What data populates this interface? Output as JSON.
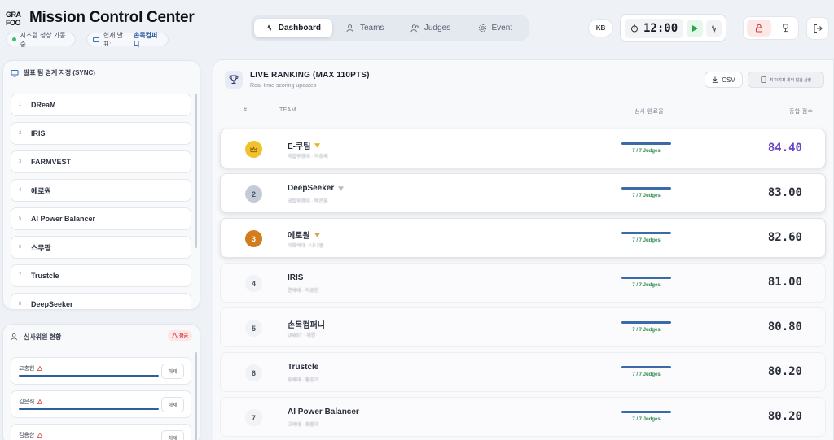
{
  "app": {
    "logo": "GRAND FOOD",
    "title": "Mission Control Center",
    "status_pill": "시스템 정상 가동 중",
    "presenting_pill_prefix": "현재 발표:",
    "presenting_team": "손목컴퍼니"
  },
  "tabs": [
    {
      "label": "Dashboard",
      "icon": "activity-icon",
      "active": true
    },
    {
      "label": "Teams",
      "icon": "users-icon",
      "active": false
    },
    {
      "label": "Judges",
      "icon": "users-icon",
      "active": false
    },
    {
      "label": "Event",
      "icon": "gear-icon",
      "active": false
    }
  ],
  "toolbar": {
    "kb_label": "KB",
    "timer": "12:00"
  },
  "sidebar": {
    "teams_title": "발표 팀 경계 지정 (SYNC)",
    "teams": [
      {
        "idx": "1",
        "name": "DReaM"
      },
      {
        "idx": "2",
        "name": "IRIS"
      },
      {
        "idx": "3",
        "name": "FARMVEST"
      },
      {
        "idx": "4",
        "name": "에로원"
      },
      {
        "idx": "5",
        "name": "AI Power Balancer"
      },
      {
        "idx": "6",
        "name": "스무팜"
      },
      {
        "idx": "7",
        "name": "Trustcle"
      },
      {
        "idx": "8",
        "name": "DeepSeeker"
      }
    ],
    "judges_title": "심사위원 현황",
    "judges_badge": "잠금",
    "judges": [
      {
        "name": "고충현",
        "action": "해제"
      },
      {
        "name": "김은석",
        "action": "해제"
      },
      {
        "name": "김용한",
        "action": "해제"
      }
    ]
  },
  "ranking": {
    "title": "LIVE RANKING (MAX 110PTS)",
    "subtitle": "Real-time scoring updates",
    "csv_label": "CSV",
    "export_label": "최고/최저 제외 점검 산출",
    "col_rank": "#",
    "col_team": "TEAM",
    "col_progress": "심사 완료율",
    "col_score": "종합 점수",
    "rows": [
      {
        "rank": "",
        "name": "E-쿠팀",
        "sub": "국립부경대 · 이승재",
        "progress": "7 / 7 Judges",
        "progress_frac": 1.0,
        "score": "84.40"
      },
      {
        "rank": "2",
        "name": "DeepSeeker",
        "sub": "국립부경대 · 박은웅",
        "progress": "7 / 7 Judges",
        "progress_frac": 1.0,
        "score": "83.00"
      },
      {
        "rank": "3",
        "name": "에로원",
        "sub": "이화여대 · 나나영",
        "progress": "7 / 7 Judges",
        "progress_frac": 1.0,
        "score": "82.60"
      },
      {
        "rank": "4",
        "name": "IRIS",
        "sub": "연세대 · 이승민",
        "progress": "7 / 7 Judges",
        "progress_frac": 1.0,
        "score": "81.00"
      },
      {
        "rank": "5",
        "name": "손목컴퍼니",
        "sub": "UNIST · 위한",
        "progress": "7 / 7 Judges",
        "progress_frac": 1.0,
        "score": "80.80"
      },
      {
        "rank": "6",
        "name": "Trustcle",
        "sub": "효세대 · 황강기",
        "progress": "7 / 7 Judges",
        "progress_frac": 1.0,
        "score": "80.20"
      },
      {
        "rank": "7",
        "name": "AI Power Balancer",
        "sub": "고려대 · 최량극",
        "progress": "7 / 7 Judges",
        "progress_frac": 1.0,
        "score": "80.20"
      }
    ]
  },
  "colors": {
    "accent": "#2d5f9c",
    "first_score": "#6a43c8",
    "gold": "#f2c12e",
    "silver": "#c5cbd6",
    "bronze": "#d27c1e",
    "complete_text": "#2f8a4a"
  }
}
